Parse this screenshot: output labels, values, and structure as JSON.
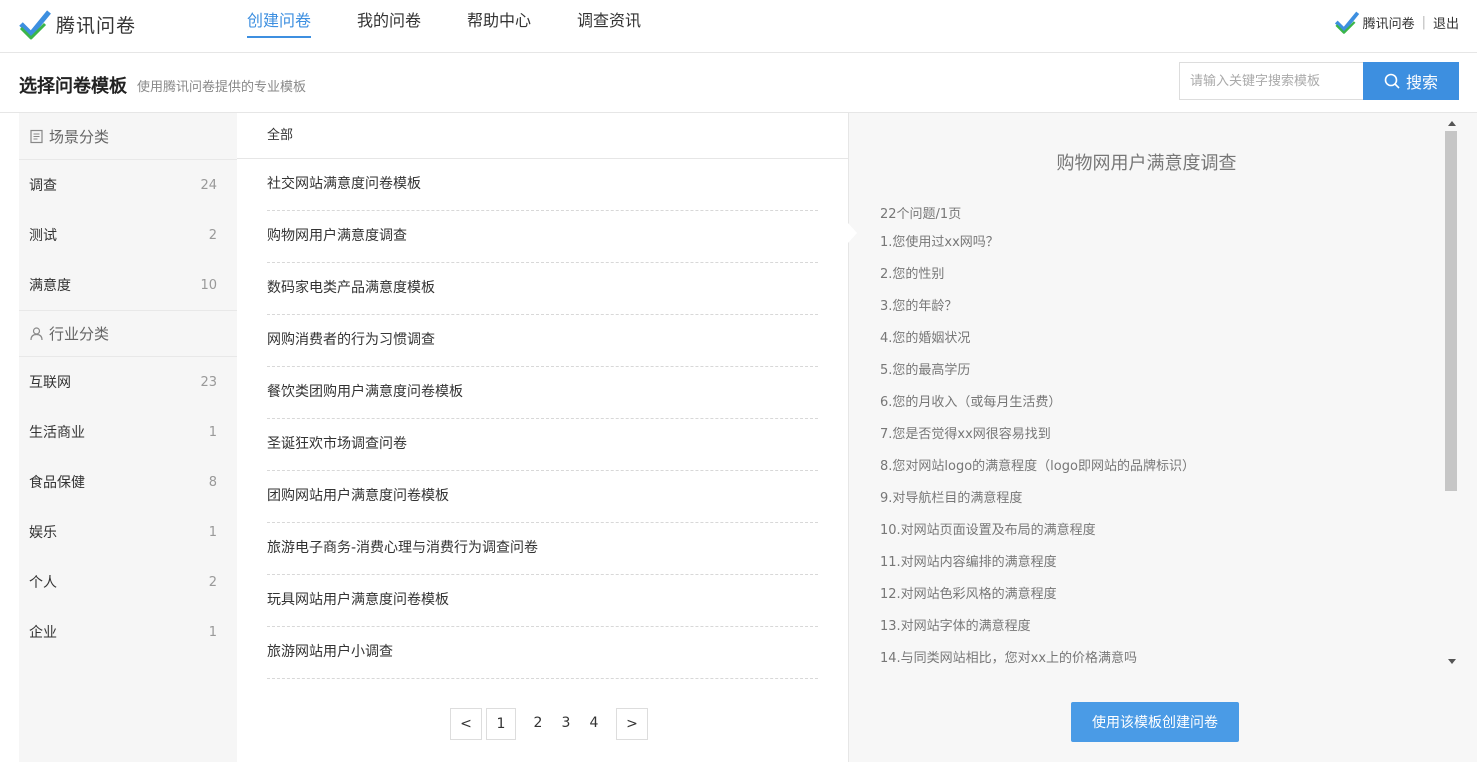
{
  "brand": {
    "name": "腾讯问卷",
    "check_color": "#3d8fe0",
    "check_color2": "#3bb54a"
  },
  "nav": {
    "items": [
      {
        "label": "创建问卷",
        "active": true
      },
      {
        "label": "我的问卷",
        "active": false
      },
      {
        "label": "帮助中心",
        "active": false
      },
      {
        "label": "调查资讯",
        "active": false
      }
    ],
    "accent": "#3d8fe0"
  },
  "user": {
    "name": "腾讯问卷",
    "separator": "|",
    "logout": "退出"
  },
  "header": {
    "title": "选择问卷模板",
    "subtitle": "使用腾讯问卷提供的专业模板",
    "search_placeholder": "请输入关键字搜索模板",
    "search_button": "搜索"
  },
  "sidebar": {
    "scene_heading": "场景分类",
    "scene_items": [
      {
        "label": "调查",
        "count": "24"
      },
      {
        "label": "测试",
        "count": "2"
      },
      {
        "label": "满意度",
        "count": "10"
      }
    ],
    "industry_heading": "行业分类",
    "industry_items": [
      {
        "label": "互联网",
        "count": "23"
      },
      {
        "label": "生活商业",
        "count": "1"
      },
      {
        "label": "食品保健",
        "count": "8"
      },
      {
        "label": "娱乐",
        "count": "1"
      },
      {
        "label": "个人",
        "count": "2"
      },
      {
        "label": "企业",
        "count": "1"
      }
    ]
  },
  "templates": {
    "header": "全部",
    "items": [
      "社交网站满意度问卷模板",
      "购物网用户满意度调查",
      "数码家电类产品满意度模板",
      "网购消费者的行为习惯调查",
      "餐饮类团购用户满意度问卷模板",
      "圣诞狂欢市场调查问卷",
      "团购网站用户满意度问卷模板",
      "旅游电子商务-消费心理与消费行为调查问卷",
      "玩具网站用户满意度问卷模板",
      "旅游网站用户小调查"
    ]
  },
  "pagination": {
    "prev": "<",
    "pages": [
      "1",
      "2",
      "3",
      "4"
    ],
    "current": "1",
    "next": ">"
  },
  "preview": {
    "title": "购物网用户满意度调查",
    "question_count": "22个问题/1页",
    "questions": [
      "1.您使用过xx网吗？",
      "2.您的性别",
      "3.您的年龄？",
      "4.您的婚姻状况",
      "5.您的最高学历",
      "6.您的月收入（或每月生活费）",
      "7.您是否觉得xx网很容易找到",
      "8.您对网站logo的满意程度（logo即网站的品牌标识）",
      "9.对导航栏目的满意程度",
      "10.对网站页面设置及布局的满意程度",
      "11.对网站内容编排的满意程度",
      "12.对网站色彩风格的满意程度",
      "13.对网站字体的满意程度",
      "14.与同类网站相比，您对xx上的价格满意吗"
    ],
    "use_button": "使用该模板创建问卷"
  }
}
